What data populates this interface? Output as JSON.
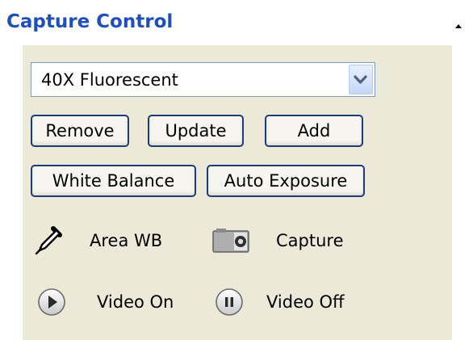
{
  "header": {
    "title": "Capture Control",
    "collapse_icon": "chevron-up-icon"
  },
  "profile": {
    "selected": "40X Fluorescent"
  },
  "buttons": {
    "remove": "Remove",
    "update": "Update",
    "add": "Add",
    "white_balance": "White Balance",
    "auto_exposure": "Auto Exposure"
  },
  "tools": {
    "area_wb": {
      "label": "Area WB",
      "icon": "eyedropper-icon"
    },
    "capture": {
      "label": "Capture",
      "icon": "camera-icon"
    },
    "video_on": {
      "label": "Video On",
      "icon": "play-icon"
    },
    "video_off": {
      "label": "Video Off",
      "icon": "pause-icon"
    }
  },
  "colors": {
    "title": "#1f4fbd",
    "panel_bg": "#ece9d8",
    "button_border": "#1c3c7a",
    "combo_border": "#7f9db9"
  }
}
